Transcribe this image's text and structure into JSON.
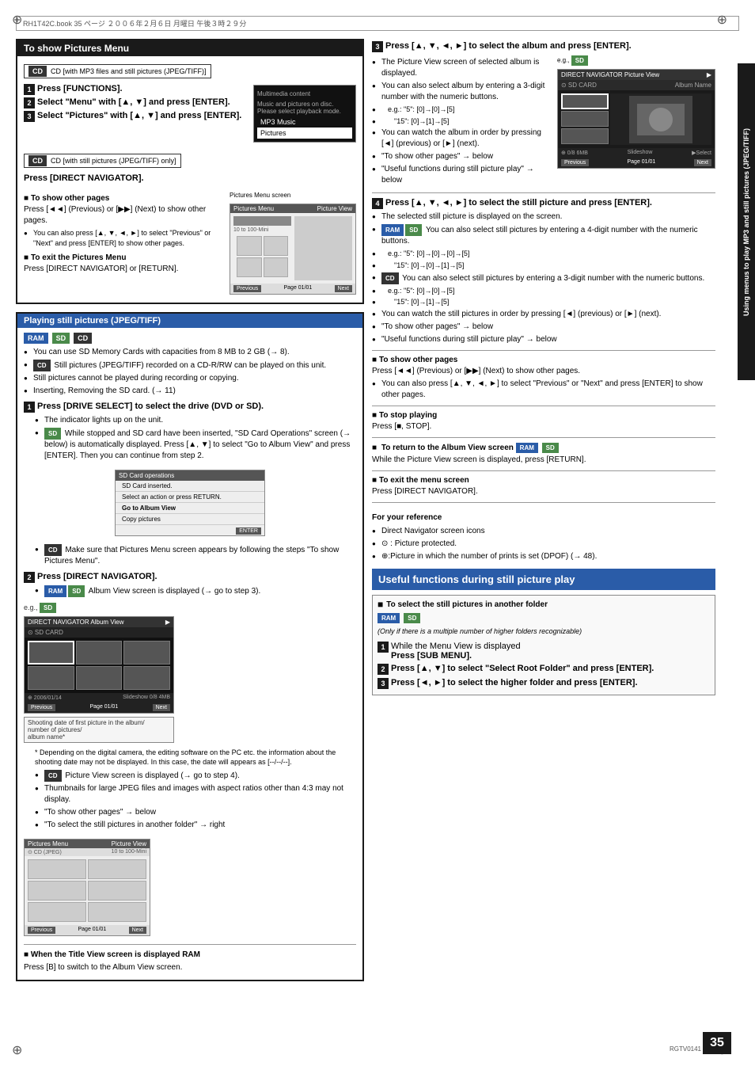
{
  "page": {
    "number": "35",
    "code": "RGTV0141",
    "header_text": "RH1T42C.book  35 ページ  ２００６年２月６日  月曜日  午後３時２９分"
  },
  "side_label": "Using menus to play MP3 and still pictures (JPEG/TIFF)",
  "sections": {
    "show_pictures_menu": {
      "title": "To show Pictures Menu",
      "cd_label": "CD [with MP3 files and still pictures (JPEG/TIFF)]",
      "steps": [
        "Press [FUNCTIONS].",
        "Select \"Menu\" with [▲, ▼] and press [ENTER].",
        "Select \"Pictures\" with [▲, ▼] and press [ENTER]."
      ],
      "cd_only_label": "CD [with still pictures (JPEG/TIFF) only]",
      "cd_only_text": "Press [DIRECT NAVIGATOR].",
      "other_pages_title": "To show other pages",
      "other_pages_text": "Press [◄◄] (Previous) or [▶▶] (Next) to show other pages.",
      "other_pages_bullet1": "You can also press [▲, ▼, ◄, ►] to select \"Previous\" or \"Next\" and press [ENTER] to show other pages.",
      "exit_title": "To exit the Pictures Menu",
      "exit_text": "Press [DIRECT NAVIGATOR] or [RETURN]."
    },
    "playing_still": {
      "title": "Playing still pictures (JPEG/TIFF)",
      "badges": [
        "RAM",
        "SD",
        "CD"
      ],
      "bullets": [
        "You can use SD Memory Cards with capacities from 8 MB to 2 GB (→ 8).",
        "CD Still pictures (JPEG/TIFF) recorded on a CD-R/RW can be played on this unit.",
        "Still pictures cannot be played during recording or copying.",
        "Inserting, Removing the SD card. (→ 11)"
      ],
      "step1": {
        "label": "1",
        "text": "Press [DRIVE SELECT] to select the drive (DVD or SD).",
        "bullets": [
          "The indicator lights up on the unit.",
          "SD While stopped and SD card have been inserted, \"SD Card Operations\" screen (→ below) is automatically displayed. Press [▲, ▼] to select \"Go to Album View\" and press [ENTER]. Then you can continue from step 2.",
          "CD Make sure that Pictures Menu screen appears by following the steps \"To show Pictures Menu\"."
        ]
      },
      "step2": {
        "label": "2",
        "text": "Press [DIRECT NAVIGATOR].",
        "bullets": [
          "RAM SD Album View screen is displayed (→ go to step 3)."
        ],
        "eg_text": "e.g., SD",
        "note": "* Depending on the digital camera, the editing software on the PC etc. the information about the shooting date may not be displayed. In this case, the date will appears as [--/--/--].",
        "cd_bullets": [
          "CD Picture View screen is displayed (→ go to step 4).",
          "Thumbnails for large JPEG files and images with aspect ratios other than 4:3 may not display.",
          "\"To show other pages\" → below",
          "\"To select the still pictures in another folder\" → right"
        ],
        "when_title_view": "When the Title View screen is displayed RAM",
        "when_title_text": "Press [B] to switch to the Album View screen."
      }
    },
    "right_column": {
      "step3": {
        "label": "3",
        "text": "Press [▲, ▼, ◄, ►] to select the album and press [ENTER].",
        "bullets": [
          "The Picture View screen of selected album is displayed.",
          "You can also select album by entering a 3-digit number with the numeric buttons.",
          "e.g.: \"5\": [0]→[0]→[5]",
          "       \"15\": [0]→[1]→[5]",
          "You can watch the album in order by pressing [◄] (previous) or [►] (next).",
          "\"To show other pages\" → below",
          "\"Useful functions during still picture play\" → below"
        ],
        "eg_label": "e.g., SD"
      },
      "step4": {
        "label": "4",
        "text": "Press [▲, ▼, ◄, ►] to select the still picture and press [ENTER].",
        "bullets": [
          "The selected still picture is displayed on the screen.",
          "RAM SD You can also select still pictures by entering a 4-digit number with the numeric buttons.",
          "e.g.: \"5\": [0]→[0]→[0]→[5]",
          "       \"15\": [0]→[0]→[1]→[5]",
          "CD You can also select still pictures by entering a 3-digit number with the numeric buttons.",
          "e.g.: \"5\": [0]→[0]→[5]",
          "       \"15\": [0]→[1]→[5]",
          "You can watch the still pictures in order by pressing [◄] (previous) or [►] (next).",
          "\"To show other pages\" → below",
          "\"Useful functions during still picture play\" → below"
        ]
      },
      "show_other_pages": {
        "title": "To show other pages",
        "text": "Press [◄◄] (Previous) or [▶▶] (Next) to show other pages.",
        "bullet": "You can also press [▲, ▼, ◄, ►] to select \"Previous\" or \"Next\" and press [ENTER] to show other pages."
      },
      "stop_playing": {
        "title": "To stop playing",
        "text": "Press [■, STOP]."
      },
      "return_album": {
        "title": "To return to the Album View screen RAM SD",
        "text": "While the Picture View screen is displayed, press [RETURN]."
      },
      "exit_menu": {
        "title": "To exit the menu screen",
        "text": "Press [DIRECT NAVIGATOR]."
      },
      "for_reference": {
        "title": "For your reference",
        "items": [
          "Direct Navigator screen icons",
          "⊙ : Picture protected.",
          "⊕:Picture in which the number of prints is set (DPOF) (→ 48)."
        ]
      },
      "useful_box": {
        "title": "Useful functions during still picture play"
      },
      "select_folder": {
        "title": "To select the still pictures in another folder",
        "badges": [
          "RAM",
          "SD"
        ],
        "note": "(Only if there is a multiple number of higher folders recognizable)",
        "step1": "While the Menu View is displayed\nPress [SUB MENU].",
        "step1_label": "1",
        "step2": "Press [▲, ▼] to select \"Select Root Folder\" and press [ENTER].",
        "step2_label": "2",
        "step3": "Press [◄, ►] to select the higher folder and press [ENTER].",
        "step3_label": "3"
      }
    }
  },
  "sd_card_operations_screen": {
    "title": "SD Card operations",
    "items": [
      "SD Card inserted.",
      "Select an action or press RETURN.",
      "Go to Album View",
      "Copy pictures"
    ],
    "enter_btn": "ENTER"
  },
  "album_view_screen": {
    "title": "DIRECT NAVIGATOR  Album View",
    "subtitle": "8 SD CARD",
    "nav": [
      "Previous",
      "Page 01/01",
      "Next"
    ]
  },
  "direct_nav_picture_view": {
    "title": "DIRECT NAVIGATOR  Picture View",
    "subtitle": "8 SD CARD",
    "nav": [
      "Previous",
      "Page 01/01",
      "Next",
      "Select"
    ]
  },
  "pictures_menu_screen": {
    "title": "Pictures Menu",
    "picture_view_title": "Picture View",
    "nav": [
      "Previous",
      "Page 01/01",
      "Next"
    ]
  }
}
